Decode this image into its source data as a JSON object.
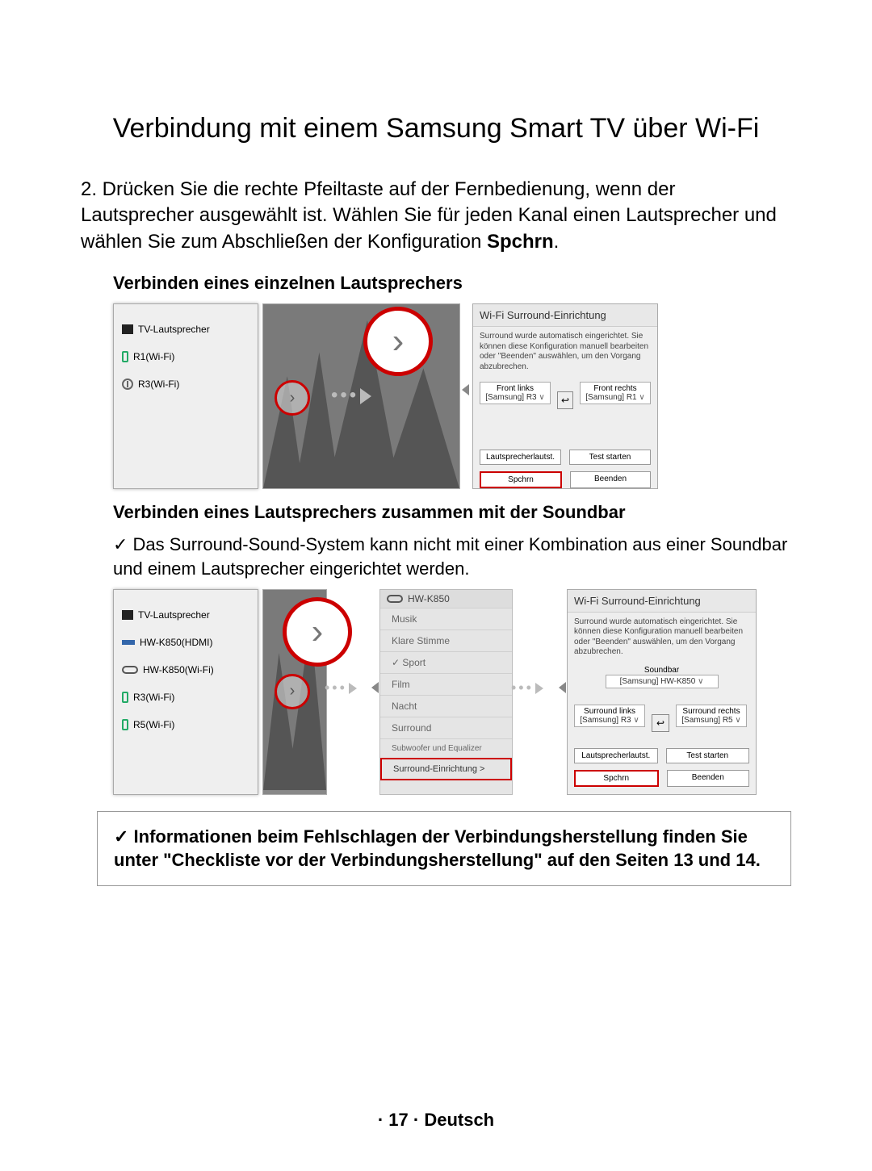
{
  "title": "Verbindung mit einem Samsung Smart TV über Wi-Fi",
  "step2_a": "2. Drücken Sie die rechte Pfeiltaste auf der Fernbedienung, wenn der Lautsprecher ausgewählt ist. Wählen Sie für jeden Kanal einen Lautsprecher und wählen Sie zum Abschließen der Konfiguration ",
  "step2_b": "Spchrn",
  "step2_c": ".",
  "sub1": "Verbinden eines einzelnen Lautsprechers",
  "sub2": "Verbinden eines Lautsprechers zusammen mit der Soundbar",
  "check1": "Das Surround-Sound-System kann nicht mit einer Kombination aus einer Soundbar und einem Lautsprecher eingerichtet werden.",
  "note": "Informationen beim Fehlschlagen der Verbindungsherstellung finden Sie unter \"Checkliste vor der Verbindungsherstellung\" auf den Seiten 13 und 14.",
  "footer_a": "· 17 · ",
  "footer_b": "Deutsch",
  "d1": {
    "speakers": {
      "tv": "TV-Lautsprecher",
      "r1": "R1(Wi-Fi)",
      "r3": "R3(Wi-Fi)"
    },
    "res": {
      "title": "Wi-Fi Surround-Einrichtung",
      "desc": "Surround wurde automatisch eingerichtet. Sie können diese Konfiguration manuell bearbeiten oder \"Beenden\" auswählen, um den Vorgang abzubrechen.",
      "fl": "Front links",
      "fr": "Front rechts",
      "flv": "[Samsung] R3",
      "frv": "[Samsung] R1",
      "b1": "Lautsprecherlautst.",
      "b2": "Test starten",
      "b3": "Spchrn",
      "b4": "Beenden"
    }
  },
  "d2": {
    "speakers": {
      "tv": "TV-Lautsprecher",
      "hdmi": "HW-K850(HDMI)",
      "wifi": "HW-K850(Wi-Fi)",
      "r3": "R3(Wi-Fi)",
      "r5": "R5(Wi-Fi)"
    },
    "menu": {
      "head": "HW-K850",
      "items": {
        "m1": "Musik",
        "m2": "Klare Stimme",
        "m3": "Sport",
        "m4": "Film",
        "m5": "Nacht",
        "m6": "Surround"
      },
      "extra": "Subwoofer und Equalizer",
      "hl": "Surround-Einrichtung >"
    },
    "res": {
      "title": "Wi-Fi Surround-Einrichtung",
      "desc": "Surround wurde automatisch eingerichtet. Sie können diese Konfiguration manuell bearbeiten oder \"Beenden\" auswählen, um den Vorgang abzubrechen.",
      "sb_lbl": "Soundbar",
      "sb_val": "[Samsung] HW-K850",
      "sl": "Surround links",
      "sr": "Surround rechts",
      "slv": "[Samsung] R3",
      "srv": "[Samsung] R5",
      "b1": "Lautsprecherlautst.",
      "b2": "Test starten",
      "b3": "Spchrn",
      "b4": "Beenden"
    }
  }
}
